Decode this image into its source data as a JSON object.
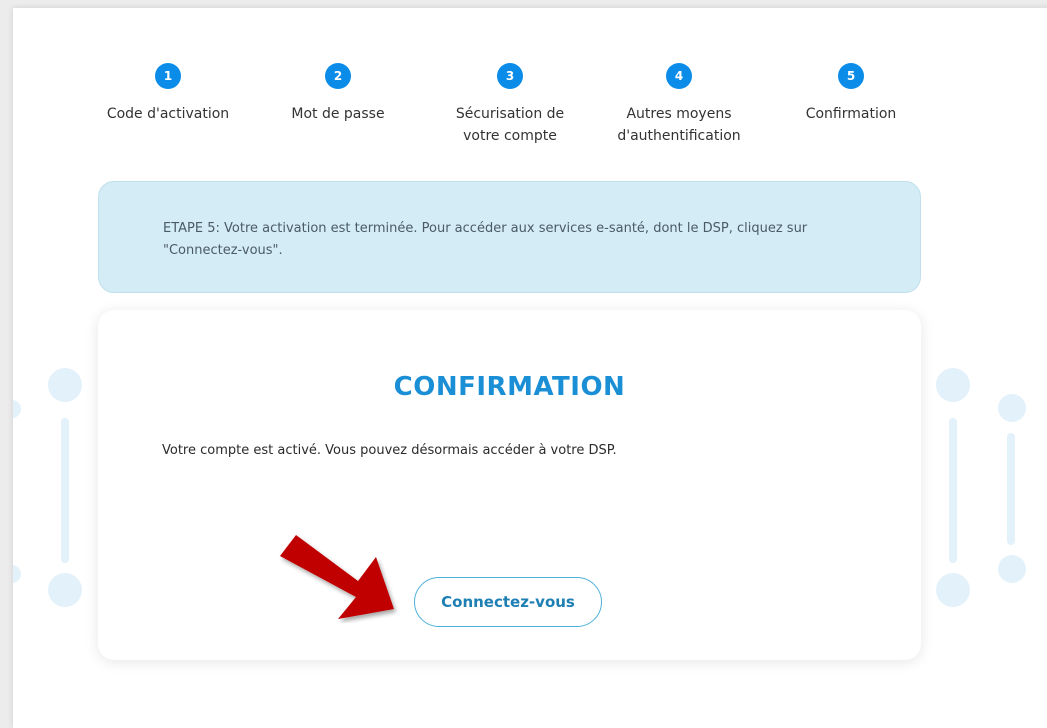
{
  "stepper": {
    "steps": [
      {
        "number": "1",
        "label": "Code d'activation"
      },
      {
        "number": "2",
        "label": "Mot de passe"
      },
      {
        "number": "3",
        "label": "Sécurisation de\nvotre compte"
      },
      {
        "number": "4",
        "label": "Autres moyens\nd'authentification"
      },
      {
        "number": "5",
        "label": "Confirmation"
      }
    ]
  },
  "banner": {
    "text": "ETAPE 5: Votre activation est terminée. Pour accéder aux services e-santé, dont le DSP, cliquez sur \"Connectez-vous\"."
  },
  "card": {
    "title": "CONFIRMATION",
    "message": "Votre compte est activé. Vous pouvez désormais accéder à votre DSP.",
    "button_label": "Connectez-vous"
  },
  "colors": {
    "accent": "#0a8ce8",
    "title": "#1a8fd6",
    "banner_bg": "#d4ecf5",
    "annotation_arrow": "#c00000"
  },
  "icons": {
    "annotation": "red-arrow-icon"
  }
}
